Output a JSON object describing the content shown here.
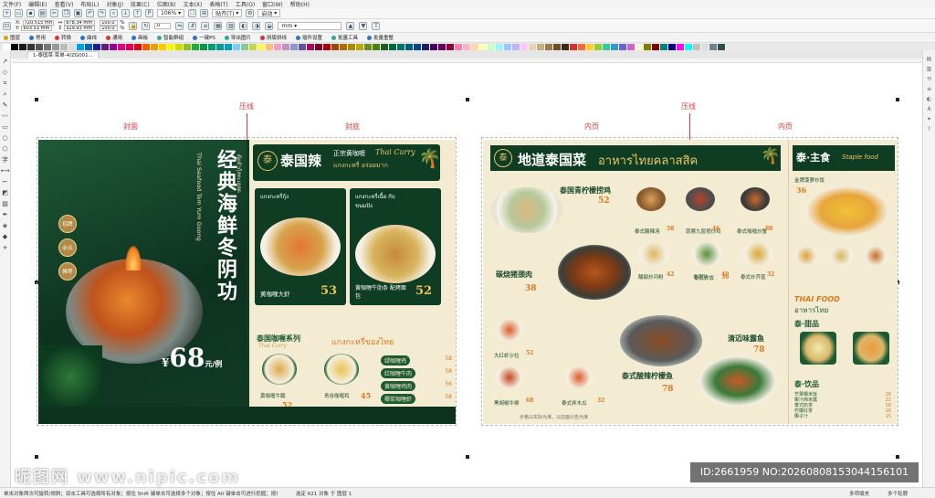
{
  "menubar": [
    "文件(F)",
    "编辑(E)",
    "查看(V)",
    "布局(L)",
    "对象(J)",
    "效果(C)",
    "位图(B)",
    "文本(X)",
    "表格(T)",
    "工具(O)",
    "窗口(W)",
    "帮助(H)"
  ],
  "toolbar1": {
    "zoom": "106%",
    "snap_label": "贴齐(T)",
    "launch_label": "启动"
  },
  "propbar": {
    "x_label": "X:",
    "x_value": "720.515 mm",
    "y_label": "Y:",
    "y_value": "603.53 mm",
    "w_value": "878.34 mm",
    "h_value": "329.93 mm",
    "scale_w": "100.0",
    "scale_h": "100.0",
    "percent": "%",
    "angle": ".0",
    "outline_unit": "mm"
  },
  "toolbar2": [
    {
      "label": "图层",
      "color": "#e39a21"
    },
    {
      "label": "常用",
      "color": "#2b73c9"
    },
    {
      "label": "转换",
      "color": "#d33"
    },
    {
      "label": "曲线",
      "color": "#2b73c9"
    },
    {
      "label": "通用",
      "color": "#d33"
    },
    {
      "label": "画板",
      "color": "#2b73c9"
    },
    {
      "label": "智能群组",
      "color": "#3a9"
    },
    {
      "label": "一键PS",
      "color": "#2b73c9"
    },
    {
      "label": "导出图片",
      "color": "#3a9"
    },
    {
      "label": "拼版拼线",
      "color": "#d33"
    },
    {
      "label": "插件设置",
      "color": "#2b73c9"
    },
    {
      "label": "批量工具",
      "color": "#3a9"
    },
    {
      "label": "批量重整",
      "color": "#2b73c9"
    }
  ],
  "palette": [
    "#ffffff",
    "#000000",
    "#1a1a1a",
    "#333",
    "#555",
    "#777",
    "#999",
    "#bbb",
    "#ddd",
    "#00a0e9",
    "#0068b7",
    "#1d2088",
    "#601986",
    "#920783",
    "#e4007f",
    "#e5004f",
    "#e60012",
    "#eb6100",
    "#f39800",
    "#fcc800",
    "#fff100",
    "#cfdb00",
    "#8fc31f",
    "#22ac38",
    "#009944",
    "#009b6b",
    "#009e96",
    "#00a0c1",
    "#7ecef4",
    "#89c997",
    "#c1d94f",
    "#fff45c",
    "#fbc17a",
    "#f19ec2",
    "#c490bf",
    "#8c97cb",
    "#5f52a0",
    "#a40b5d",
    "#7d0022",
    "#a4000f",
    "#a84200",
    "#ad6a00",
    "#b28500",
    "#b7aa00",
    "#6b8e23",
    "#4d7c0f",
    "#1b5e20",
    "#006837",
    "#00736d",
    "#005e7c",
    "#004986",
    "#1c1f5e",
    "#440062",
    "#6a005f",
    "#93003a",
    "#ff7bac",
    "#ffb3c6",
    "#ffd6a5",
    "#fdffb6",
    "#caffbf",
    "#9bf6ff",
    "#a0c4ff",
    "#bdb2ff",
    "#ffc6ff",
    "#e7d5b8",
    "#c8ad7f",
    "#9e7a47",
    "#6f4e2a",
    "#3e2a14",
    "#cc3333",
    "#ff6633",
    "#ffcc33",
    "#99cc33",
    "#33cc99",
    "#3399cc",
    "#6666cc",
    "#cc66cc",
    "#f5f5dc",
    "#808000",
    "#800000",
    "#008080",
    "#000080",
    "#ff00ff",
    "#00ffff",
    "#c0c0c0",
    "#dcdcdc",
    "#708090",
    "#2f4f4f"
  ],
  "tab": {
    "label": "1-泰国菜·菜单-4/ZG001..."
  },
  "labels": {
    "cover": "封面",
    "crease1": "压线",
    "back": "封底",
    "inner1": "内页",
    "crease2": "压线",
    "inner2": "内页"
  },
  "board_left": {
    "title": "经典海鲜冬阴功",
    "en": "Thai Seafood Tom Yum Goong",
    "thai": "ต้มยำกุ้งทะเลสด",
    "price": "68",
    "price_prefix": "¥",
    "price_unit": "元/例",
    "badges": [
      "招牌",
      "必点",
      "推荐"
    ],
    "section1_title": "泰国辣",
    "section1_sub": "正宗黄咖喱",
    "section1_en": "Thai Curry",
    "section1_thai": "แกงกะหรี่ อร่อยมาก",
    "card1_thai": "แกงกะหรี่กุ้ง",
    "card1_name": "黄咖喱大虾",
    "card1_price": "53",
    "card2_thai": "แกงกะหรี่เนื้อ กับขนมปัง",
    "card2_name": "黄咖喱牛肋条 配烤面包",
    "card2_price": "52",
    "section2_title": "泰国咖喱系列",
    "section2_en": "Thai Curry",
    "section2_thai": "แกงกะหรี่ของไทย",
    "small1_name": "黄咖喱牛腩",
    "small1_price": "52",
    "small2_name": "青谷咖喱鸡",
    "small2_price": "45",
    "list": [
      {
        "name": "绿咖喱鸡",
        "price": "58"
      },
      {
        "name": "红咖喱牛肉",
        "price": "58"
      },
      {
        "name": "黄咖喱鸡肉",
        "price": "56"
      },
      {
        "name": "椰浆咖喱虾",
        "price": "58"
      }
    ]
  },
  "board_right": {
    "title": "地道泰国菜",
    "thai_title": "อาหารไทยคลาสสิค",
    "dish1_name": "泰国青柠檬捞鸡",
    "dish1_price": "52",
    "dish2_name": "碳烧猪颈肉",
    "dish2_price": "38",
    "dish3_name": "清迈味露鱼",
    "dish3_price": "78",
    "dish4_name": "泰式酸辣柠檬鱼",
    "dish4_price": "78",
    "mini": [
      {
        "name": "泰式酸辣汤",
        "price": "58"
      },
      {
        "name": "蒜蓉九层塔炒鸡",
        "price": "46"
      },
      {
        "name": "泰式咖喱炒蟹",
        "price": "88"
      },
      {
        "name": "酸甜炒河粉",
        "price": "42"
      },
      {
        "name": "冬阴功",
        "price": "40"
      },
      {
        "name": "泰式炒芥蓝",
        "price": "32"
      },
      {
        "name": "大红虾沙拉",
        "price": "52"
      },
      {
        "name": "黑胡椒牛柳",
        "price": "68"
      },
      {
        "name": "泰式拌木瓜",
        "price": "32"
      },
      {
        "name": "泰式炒饭",
        "price": "36"
      }
    ],
    "footer": "价格以实际为准，以店面公告为准",
    "side_title": "泰·主食",
    "side_en": "Staple food",
    "side_pine": "金牌菠萝炒饭",
    "side_pine_price": "36",
    "side_thai_food": "THAI FOOD",
    "side_thai": "อาหารไทย",
    "side_sweet": "泰·甜品",
    "side_drink": "泰·饮品",
    "side_list": [
      {
        "name": "芒果糯米饭",
        "price": "28"
      },
      {
        "name": "椰汁西米露",
        "price": "22"
      },
      {
        "name": "泰式奶茶",
        "price": "18"
      },
      {
        "name": "柠檬红茶",
        "price": "16"
      },
      {
        "name": "椰子汁",
        "price": "15"
      }
    ]
  },
  "watermark": "昵图网 www.nipic.com",
  "id_text": "ID:2661959 NO:20260808153044156101",
  "status": {
    "left": "单击对象两次可旋转/倾斜；双击工具可选择所有对象；按住 Shift 键单击可选择多个对象；按住 Alt 键单击可进行挖掘；按住 Ctrl 并单击可在群组中选择",
    "mid": "选定 621 对象 于 图层 1",
    "fill": "多项填充",
    "outline": "多个轮廓"
  }
}
